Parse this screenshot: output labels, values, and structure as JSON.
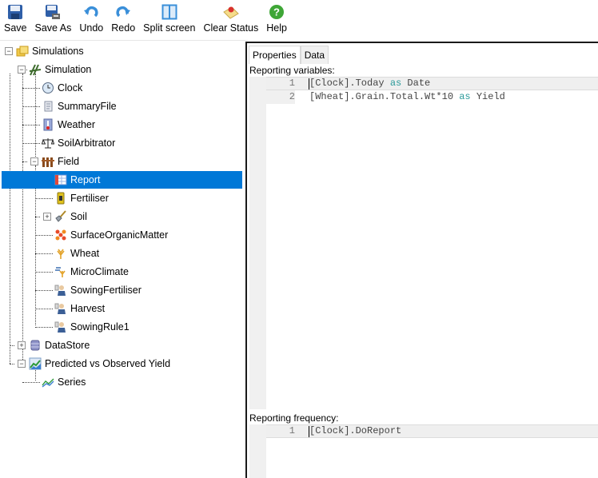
{
  "toolbar": {
    "buttons": [
      {
        "label": "Save",
        "icon": "save-icon"
      },
      {
        "label": "Save As",
        "icon": "save-as-icon"
      },
      {
        "label": "Undo",
        "icon": "undo-icon"
      },
      {
        "label": "Redo",
        "icon": "redo-icon"
      },
      {
        "label": "Split screen",
        "icon": "split-screen-icon"
      },
      {
        "label": "Clear Status",
        "icon": "clear-status-icon"
      },
      {
        "label": "Help",
        "icon": "help-icon"
      }
    ]
  },
  "tree": {
    "nodes": [
      {
        "label": "Simulations",
        "icon": "simulations-folder-icon",
        "expanded": true
      },
      {
        "label": "Simulation",
        "icon": "simulation-icon",
        "expanded": true
      },
      {
        "label": "Clock",
        "icon": "clock-icon"
      },
      {
        "label": "SummaryFile",
        "icon": "summary-file-icon"
      },
      {
        "label": "Weather",
        "icon": "weather-icon"
      },
      {
        "label": "SoilArbitrator",
        "icon": "scales-icon"
      },
      {
        "label": "Field",
        "icon": "field-fence-icon",
        "expanded": true
      },
      {
        "label": "Report",
        "icon": "report-icon",
        "selected": true
      },
      {
        "label": "Fertiliser",
        "icon": "fertiliser-icon"
      },
      {
        "label": "Soil",
        "icon": "shovel-icon",
        "expanded": false
      },
      {
        "label": "SurfaceOrganicMatter",
        "icon": "organic-matter-icon"
      },
      {
        "label": "Wheat",
        "icon": "wheat-icon"
      },
      {
        "label": "MicroClimate",
        "icon": "microclimate-icon"
      },
      {
        "label": "SowingFertiliser",
        "icon": "manager-icon"
      },
      {
        "label": "Harvest",
        "icon": "manager-icon"
      },
      {
        "label": "SowingRule1",
        "icon": "manager-icon"
      },
      {
        "label": "DataStore",
        "icon": "database-icon",
        "expanded": false
      },
      {
        "label": "Predicted vs Observed Yield",
        "icon": "graph-icon",
        "expanded": true
      },
      {
        "label": "Series",
        "icon": "series-icon"
      }
    ]
  },
  "right": {
    "tabs": [
      {
        "label": "Properties",
        "active": true
      },
      {
        "label": "Data",
        "active": false
      }
    ],
    "reporting_variables_label": "Reporting variables:",
    "reporting_variables": [
      {
        "num": "1",
        "pre": "[Clock].Today ",
        "kw": "as",
        "post": " Date"
      },
      {
        "num": "2",
        "pre": "[Wheat].Grain.Total.Wt*10 ",
        "kw": "as",
        "post": " Yield"
      }
    ],
    "reporting_frequency_label": "Reporting frequency:",
    "reporting_frequency": [
      {
        "num": "1",
        "pre": "[Clock].DoReport",
        "kw": "",
        "post": ""
      }
    ]
  },
  "colors": {
    "selection": "#0078d7",
    "keyword": "#2b9a9a"
  }
}
